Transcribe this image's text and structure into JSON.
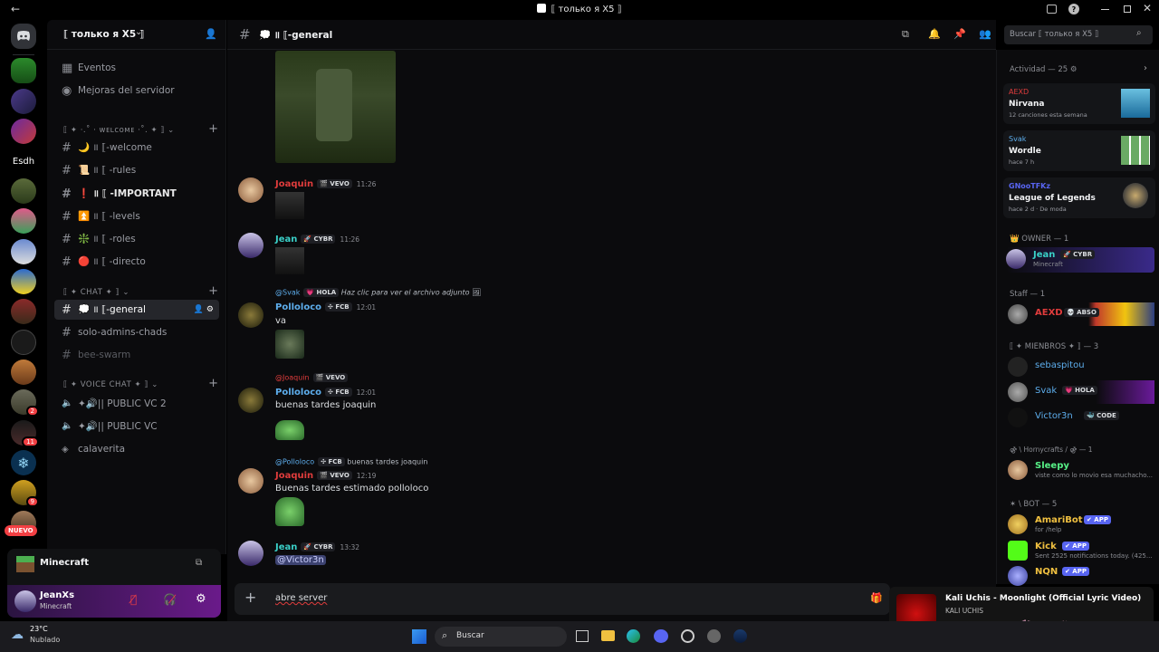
{
  "window": {
    "title": "⟦ только я X5 ⟧",
    "back_arrow": "←"
  },
  "rail": {
    "esdh_label": "Esdh",
    "nuevo_label": "NUEVO",
    "badges": [
      "2",
      "11",
      "9"
    ]
  },
  "server": {
    "name": "⟦ только я X5 ⟧"
  },
  "nav": {
    "events": "Eventos",
    "boost": "Mejoras del servidor"
  },
  "categories": {
    "welcome": "⟦ ✦ ·.˚ · ᴡᴇʟᴄᴏᴍᴇ ·˚. ✦ ⟧",
    "chat": "⟦ ✦ CHAT ✦ ⟧",
    "voice": "⟦ ✦ VOICE CHAT ✦ ⟧"
  },
  "channels": {
    "welcome": "🌙 ॥ ⟦-welcome",
    "rules": "📜 ॥ ⟦ -rules",
    "important": "❗ ॥ ⟦ -IMPORTANT",
    "levels": "⏫ ॥ ⟦ -levels",
    "roles": "❇️ ॥ ⟦ -roles",
    "directo": "🔴 ॥ ⟦ -directo",
    "general": "💭 ॥ ⟦-general",
    "solo_admins": "solo-admins-chads",
    "bee_swarm": "bee-swarm",
    "vc2": "✦🔊|| PUBLIC VC 2",
    "vc": "✦🔊|| PUBLIC VC",
    "calaverita": "calaverita"
  },
  "game_panel": {
    "title": "Minecraft"
  },
  "user": {
    "name": "JeanXs",
    "status": "Minecraft"
  },
  "chat": {
    "channel_name": "💭 ॥ ⟦-general",
    "search_placeholder": "Buscar ⟦ только я X5 ⟧",
    "input_value": "abre server",
    "messages": [
      {
        "author": "Joaquin",
        "tag": "🎬 VEVO",
        "time": "11:26"
      },
      {
        "author": "Jean",
        "tag": "🚀 CYBR",
        "time": "11:26"
      },
      {
        "reply_author": "@Svak",
        "reply_tag": "💗 HOLA",
        "reply_text": "Haz clic para ver el archivo adjunto",
        "author": "Polloloco",
        "tag": "✣ FCB",
        "time": "12:01",
        "text": "va"
      },
      {
        "reply_author": "@Joaquin",
        "reply_tag": "🎬 VEVO",
        "author": "Polloloco",
        "tag": "✣ FCB",
        "time": "12:01",
        "text": "buenas tardes joaquin"
      },
      {
        "reply_author": "@Polloloco",
        "reply_tag": "✣ FCB",
        "reply_text": "buenas tardes joaquin",
        "author": "Joaquin",
        "tag": "🎬 VEVO",
        "time": "12:19",
        "text": "Buenas tardes estimado polloloco"
      },
      {
        "author": "Jean",
        "tag": "🚀 CYBR",
        "time": "13:32",
        "text": "@Victor3n"
      }
    ]
  },
  "members": {
    "activity_header": "Actividad — 25 ⚙",
    "activities": [
      {
        "user": "AEXD",
        "title": "Nirvana",
        "sub": "12 canciones esta semana"
      },
      {
        "user": "Svak",
        "title": "Wordle",
        "sub": "hace 7 h"
      },
      {
        "user": "GNooTFKz",
        "title": "League of Legends",
        "sub": "hace 2 d · De moda"
      }
    ],
    "owner_header": "👑 OWNER — 1",
    "staff_header": "Staff — 1",
    "mienbros_header": "⟦ ✦ MIENBROS ✦ ⟧ — 3",
    "horny_header": "⚣ \\ Hornycrafts / ⚣ — 1",
    "bot_header": "✶ \\ BOT — 5",
    "list": [
      {
        "name": "Jean",
        "tag": "🚀 CYBR",
        "sub": "Minecraft"
      },
      {
        "name": "AEXD",
        "tag": "💀 ABSO",
        "sub": ""
      },
      {
        "name": "sebaspitou",
        "tag": "",
        "sub": ""
      },
      {
        "name": "Svak",
        "tag": "💗 HOLA",
        "sub": ""
      },
      {
        "name": "Victor3n",
        "tag": "🐳 CODE",
        "sub": ""
      },
      {
        "name": "Sleepy",
        "tag": "",
        "sub": "viste como lo movio esa muchacho..."
      },
      {
        "name": "AmariBot",
        "tag": "✔ APP",
        "sub": "for /help"
      },
      {
        "name": "Kick",
        "tag": "✔ APP",
        "sub": "Sent 2525 notifications today. (425..."
      },
      {
        "name": "NQN",
        "tag": "✔ APP",
        "sub": ""
      }
    ]
  },
  "media": {
    "title": "Kali Uchis - Moonlight (Official Lyric Video)",
    "artist": "KALI UCHIS"
  },
  "taskbar": {
    "temp": "23°C",
    "weather": "Nublado",
    "search": "Buscar"
  },
  "colors": {
    "accent": "#5865f2",
    "red": "#f23f43",
    "green": "#23a55a",
    "joaquin": "#e03c3c",
    "jean": "#3ad0c8",
    "polloloco": "#5dadec"
  }
}
